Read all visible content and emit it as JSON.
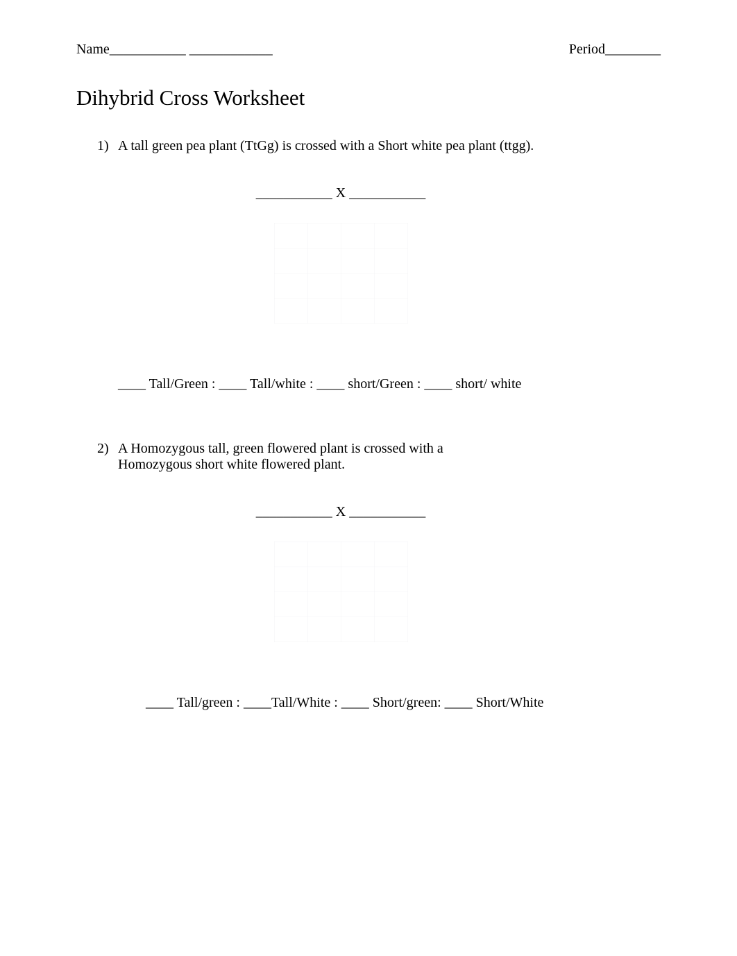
{
  "header": {
    "name_label": "Name___________ ____________",
    "period_label": "Period________"
  },
  "title": "Dihybrid Cross Worksheet",
  "q1": {
    "number": "1)",
    "text": "A tall green pea plant (TtGg) is crossed with a Short white pea plant (ttgg).",
    "cross": "___________ X ___________",
    "ratio": "____ Tall/Green : ____ Tall/white : ____ short/Green : ____ short/ white"
  },
  "q2": {
    "number": "2)",
    "text_line1": " A Homozygous tall, green  flowered plant is crossed with a",
    "text_line2": "Homozygous short white flowered plant.",
    "cross": "___________ X ___________",
    "ratio": "____ Tall/green : ____Tall/White : ____ Short/green: ____ Short/White"
  }
}
